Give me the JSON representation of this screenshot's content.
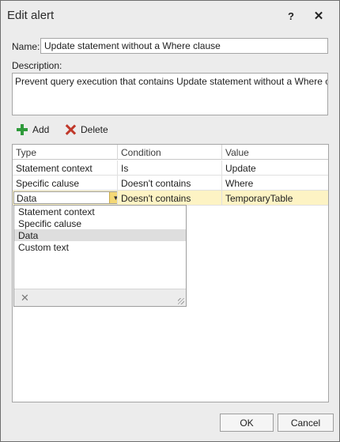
{
  "window": {
    "title": "Edit alert",
    "help_glyph": "?",
    "close_glyph": "✕"
  },
  "form": {
    "name_label": "Name:",
    "name_value": "Update statement without a Where clause",
    "description_label": "Description:",
    "description_value": "Prevent query execution that contains Update statement without a Where clause"
  },
  "toolbar": {
    "add_label": "Add",
    "delete_label": "Delete"
  },
  "grid": {
    "columns": [
      "Type",
      "Condition",
      "Value"
    ],
    "rows": [
      {
        "type": "Statement context",
        "condition": "Is",
        "value": "Update"
      },
      {
        "type": "Specific caluse",
        "condition": "Doesn't contains",
        "value": "Where"
      },
      {
        "type": "Data",
        "condition": "Doesn't contains",
        "value": "TemporaryTable"
      }
    ],
    "active_row": 2
  },
  "dropdown": {
    "options": [
      "Statement context",
      "Specific caluse",
      "Data",
      "Custom text"
    ],
    "selected": "Data",
    "clear_glyph": "✕",
    "arrow_glyph": "▼"
  },
  "buttons": {
    "ok_label": "OK",
    "cancel_label": "Cancel"
  },
  "colors": {
    "active_row": "#fdf3c4",
    "add_icon": "#2f9a3b",
    "delete_icon": "#c0392b",
    "dropdown_button": "#f4d875"
  }
}
